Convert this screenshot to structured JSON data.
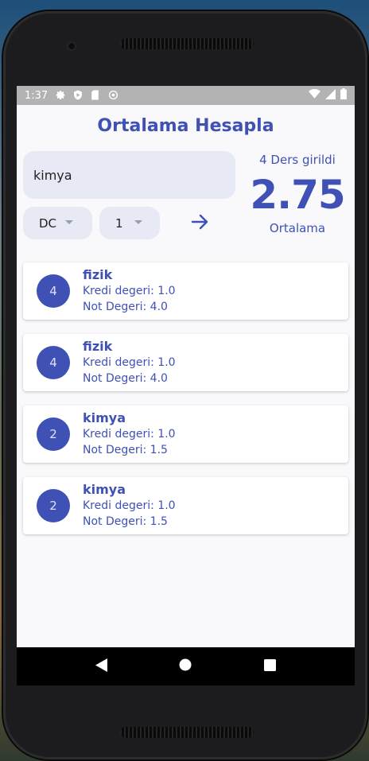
{
  "status_bar": {
    "time": "1:37"
  },
  "app": {
    "title": "Ortalama Hesapla"
  },
  "form": {
    "course_input_value": "kimya",
    "letter_grade": "DC",
    "credit": "1"
  },
  "summary": {
    "count_text": "4 Ders girildi",
    "average": "2.75",
    "average_label": "Ortalama"
  },
  "courses": [
    {
      "avatar": "4",
      "name": "fizik",
      "credit_text": "Kredi degeri: 1.0",
      "grade_text": "Not Degeri: 4.0"
    },
    {
      "avatar": "4",
      "name": "fizik",
      "credit_text": "Kredi degeri: 1.0",
      "grade_text": "Not Degeri: 4.0"
    },
    {
      "avatar": "2",
      "name": "kimya",
      "credit_text": "Kredi degeri: 1.0",
      "grade_text": "Not Degeri: 1.5"
    },
    {
      "avatar": "2",
      "name": "kimya",
      "credit_text": "Kredi degeri: 1.0",
      "grade_text": "Not Degeri: 1.5"
    }
  ],
  "colors": {
    "primary": "#3f51b5",
    "field_bg": "#e7e9f4",
    "status_bar": "#b3b3b3",
    "nav_bar": "#000000"
  },
  "icons": {
    "status": [
      "settings-icon",
      "play-protect-icon",
      "sd-card-icon",
      "sync-icon",
      "wifi-icon",
      "signal-icon",
      "battery-icon"
    ],
    "add": "arrow-right-icon",
    "nav": [
      "back-icon",
      "home-icon",
      "recents-icon"
    ]
  }
}
